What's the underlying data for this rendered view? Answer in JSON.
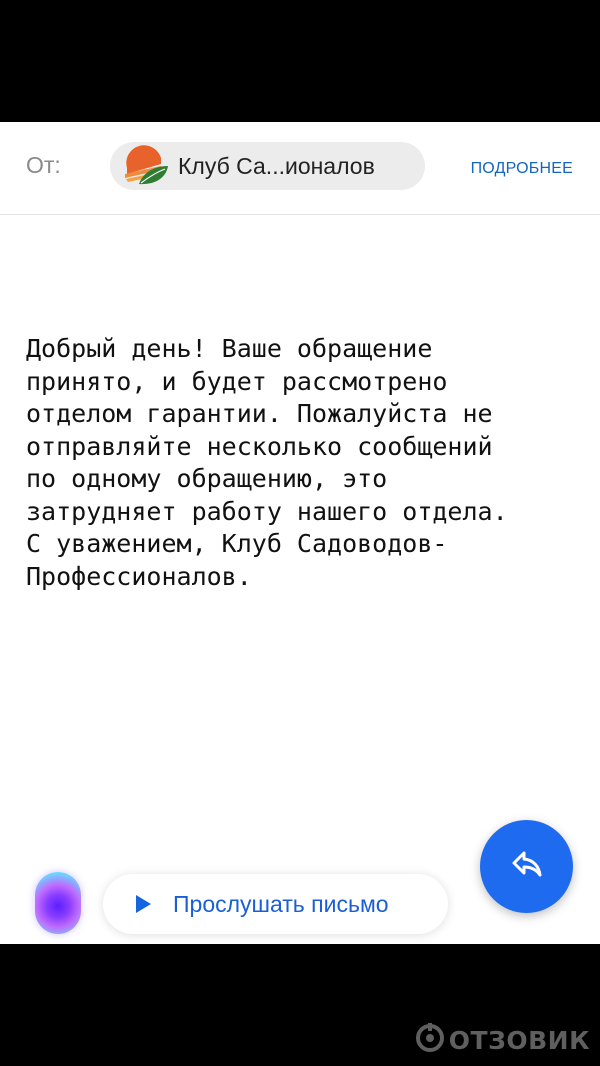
{
  "header": {
    "from_label": "От:",
    "sender_name": "Клуб Са...ионалов",
    "details_link": "ПОДРОБНЕЕ"
  },
  "message": {
    "body": "Добрый день! Ваше обращение\nпринято, и будет рассмотрено\nотделом гарантии. Пожалуйста не\nотправляйте несколько сообщений\nпо одному обращению, это\nзатрудняет работу нашего отдела.\nС уважением, Клуб Садоводов-\nПрофессионалов."
  },
  "bottom_bar": {
    "listen_label": "Прослушать письмо"
  },
  "watermark": {
    "text": "ОТЗОВИК"
  },
  "colors": {
    "accent_blue": "#1f6bf0",
    "link_blue": "#1565c0",
    "logo_orange": "#e8622c",
    "logo_green": "#2e7d32"
  },
  "icons": {
    "sender_logo": "garden-club-logo",
    "play": "play-icon",
    "reply": "reply-icon",
    "assistant": "voice-assistant-orb"
  }
}
